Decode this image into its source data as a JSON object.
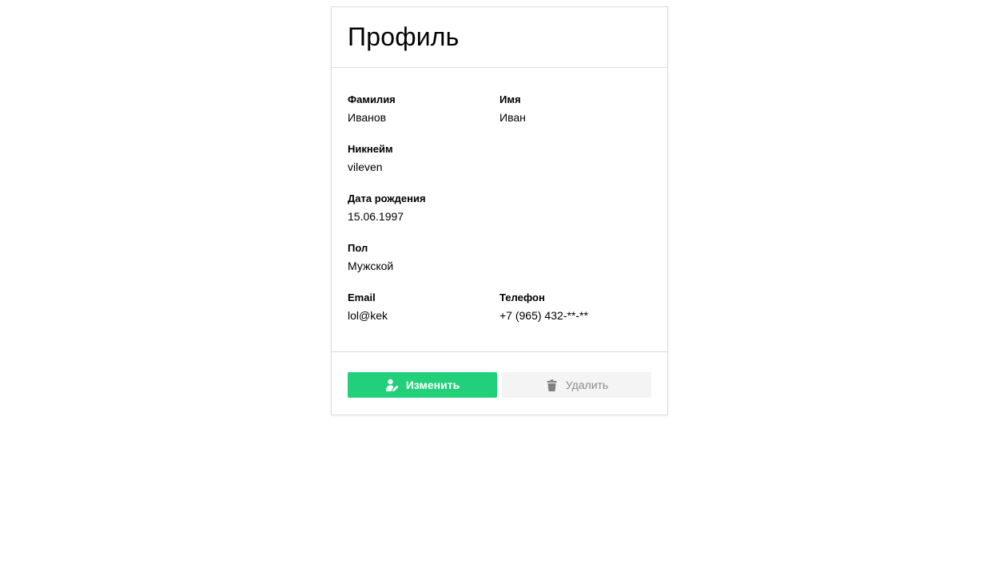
{
  "header": {
    "title": "Профиль"
  },
  "profile": {
    "last_name": {
      "label": "Фамилия",
      "value": "Иванов"
    },
    "first_name": {
      "label": "Имя",
      "value": "Иван"
    },
    "nickname": {
      "label": "Никнейм",
      "value": "vileven"
    },
    "birth_date": {
      "label": "Дата рождения",
      "value": "15.06.1997"
    },
    "gender": {
      "label": "Пол",
      "value": "Мужской"
    },
    "email": {
      "label": "Email",
      "value": "lol@kek"
    },
    "phone": {
      "label": "Телефон",
      "value": "+7 (965) 432-**-**"
    }
  },
  "actions": {
    "edit": {
      "label": "Изменить",
      "icon": "user-edit-icon",
      "color": "#22d07b"
    },
    "delete": {
      "label": "Удалить",
      "icon": "trash-icon",
      "color": "#f4f4f4"
    }
  }
}
